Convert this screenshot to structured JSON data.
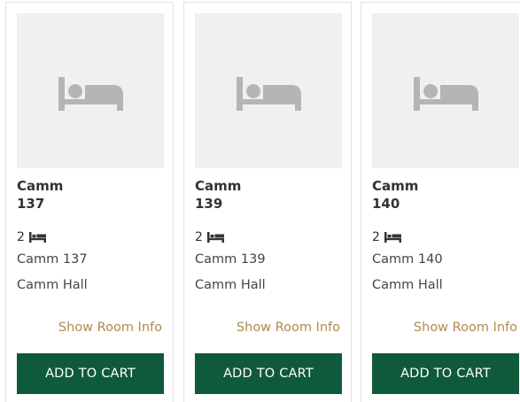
{
  "colors": {
    "accent_button": "#0e5a3a",
    "link": "#b08a52",
    "image_placeholder": "#f0f0f0",
    "icon": "#b5b5b5"
  },
  "rooms": [
    {
      "title_line1": "Camm",
      "title_line2": "137",
      "beds": "2",
      "bed_icon": "bed-icon",
      "room_name": "Camm 137",
      "hall": "Camm Hall",
      "info_link": "Show Room Info",
      "cart_button": "ADD TO CART"
    },
    {
      "title_line1": "Camm",
      "title_line2": "139",
      "beds": "2",
      "bed_icon": "bed-icon",
      "room_name": "Camm 139",
      "hall": "Camm Hall",
      "info_link": "Show Room Info",
      "cart_button": "ADD TO CART"
    },
    {
      "title_line1": "Camm",
      "title_line2": "140",
      "beds": "2",
      "bed_icon": "bed-icon",
      "room_name": "Camm 140",
      "hall": "Camm Hall",
      "info_link": "Show Room Info",
      "cart_button": "ADD TO CART"
    }
  ]
}
